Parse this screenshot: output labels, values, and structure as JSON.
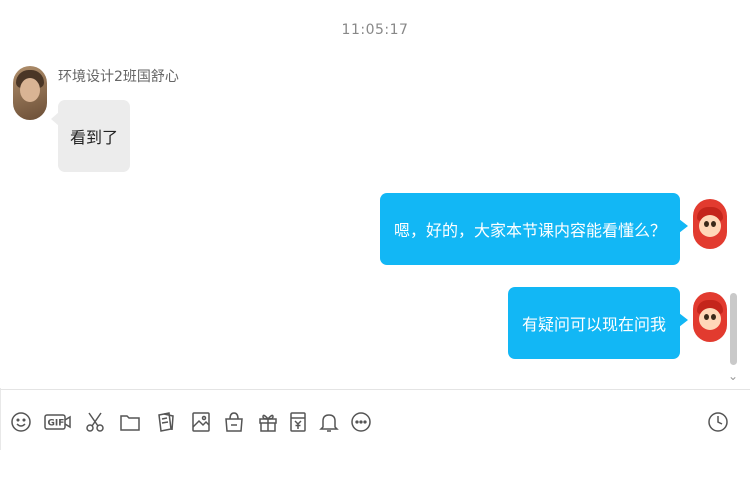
{
  "chat": {
    "timestamp": "11:05:17",
    "messages": [
      {
        "direction": "incoming",
        "sender": "环境设计2班国舒心",
        "text": "看到了"
      },
      {
        "direction": "outgoing",
        "text": "嗯，好的，大家本节课内容能看懂么？"
      },
      {
        "direction": "outgoing",
        "text": "有疑问可以现在问我"
      }
    ]
  },
  "toolbar": {
    "icons": [
      "emoji-icon",
      "gif-icon",
      "scissors-icon",
      "folder-icon",
      "doc-icon",
      "image-icon",
      "gift-bag-icon",
      "gift-icon",
      "red-packet-icon",
      "bell-icon",
      "more-icon",
      "history-icon"
    ]
  },
  "colors": {
    "outgoing_bubble": "#12b7f5",
    "incoming_bubble": "#ececec"
  }
}
